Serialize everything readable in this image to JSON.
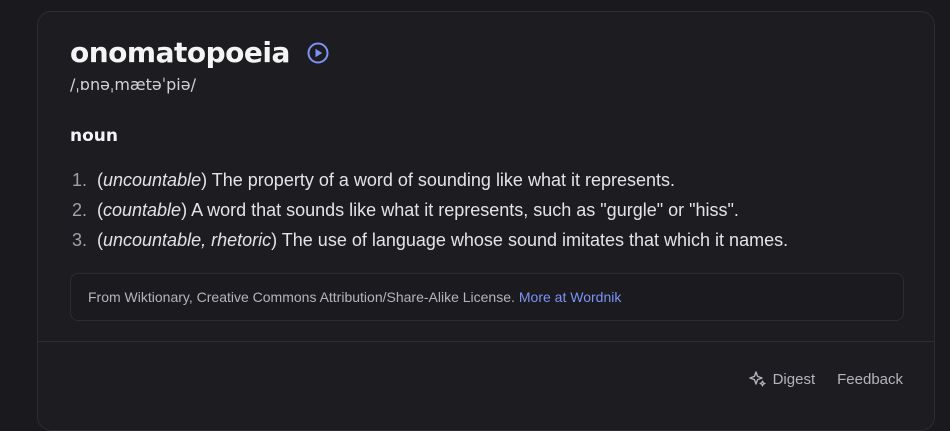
{
  "entry": {
    "word": "onomatopoeia",
    "phonetic": "/ˌɒnəˌmætəˈpiə/",
    "part_of_speech": "noun",
    "definitions": [
      {
        "number": "1.",
        "open": "(",
        "qualifier": "uncountable",
        "close": ")",
        "text": " The property of a word of sounding like what it represents."
      },
      {
        "number": "2.",
        "open": "(",
        "qualifier": "countable",
        "close": ")",
        "text": " A word that sounds like what it represents, such as \"gurgle\" or \"hiss\"."
      },
      {
        "number": "3.",
        "open": "(",
        "qualifier": "uncountable, rhetoric",
        "close": ")",
        "text": " The use of language whose sound imitates that which it names."
      }
    ]
  },
  "source": {
    "text": "From Wiktionary, Creative Commons Attribution/Share-Alike License.",
    "link_label": "More at Wordnik"
  },
  "footer": {
    "digest_label": "Digest",
    "feedback_label": "Feedback"
  },
  "icons": {
    "play": "play-circle-icon",
    "digest": "sparkle-icon"
  },
  "colors": {
    "accent": "#7b93f5",
    "background": "#1c1c21"
  }
}
